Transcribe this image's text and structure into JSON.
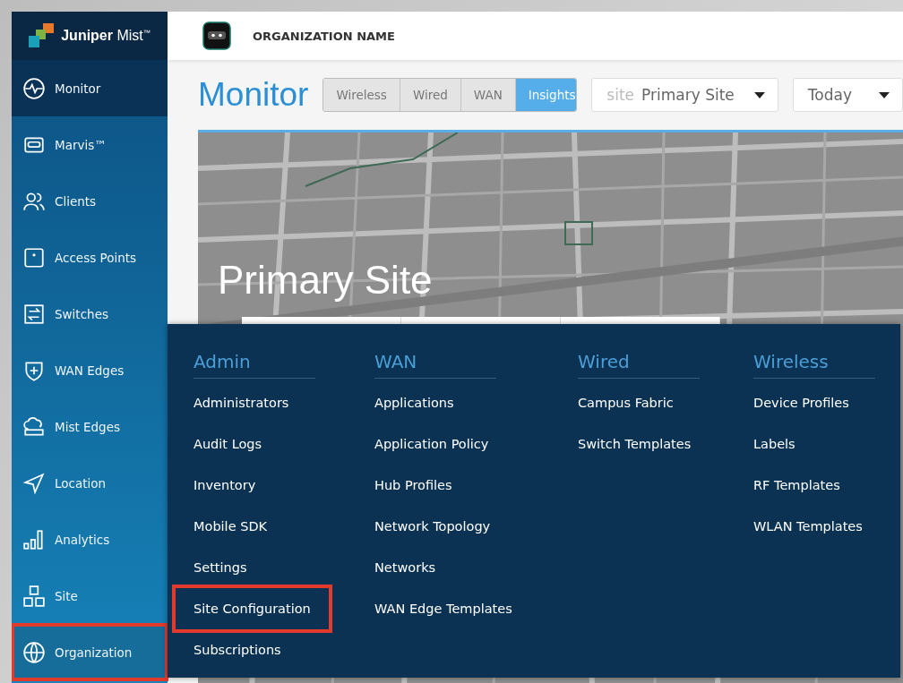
{
  "brand": {
    "name": "**Juniper** Mist$^{™}$"
  },
  "header": {
    "org_name": "ORGANIZATION NAME"
  },
  "sidebar": {
    "items": [
      {
        "label": "Monitor",
        "selected": true,
        "highlighted": false
      },
      {
        "label": "Marvis™",
        "selected": false,
        "highlighted": false
      },
      {
        "label": "Clients",
        "selected": false,
        "highlighted": false
      },
      {
        "label": "Access Points",
        "selected": false,
        "highlighted": false
      },
      {
        "label": "Switches",
        "selected": false,
        "highlighted": false
      },
      {
        "label": "WAN Edges",
        "selected": false,
        "highlighted": false
      },
      {
        "label": "Mist Edges",
        "selected": false,
        "highlighted": false
      },
      {
        "label": "Location",
        "selected": false,
        "highlighted": false
      },
      {
        "label": "Analytics",
        "selected": false,
        "highlighted": false
      },
      {
        "label": "Site",
        "selected": false,
        "highlighted": false
      },
      {
        "label": "Organization",
        "selected": false,
        "highlighted": true
      }
    ]
  },
  "page": {
    "title": "Monitor",
    "tabs": [
      {
        "label": "Wireless",
        "selected": false
      },
      {
        "label": "Wired",
        "selected": false
      },
      {
        "label": "WAN",
        "selected": false
      },
      {
        "label": "Insights",
        "selected": true
      }
    ],
    "site_filter": {
      "prefix": "site",
      "value": "Primary Site"
    },
    "time_filter": {
      "value": "Today"
    }
  },
  "map": {
    "kind": "picture",
    "site_name": "Primary Site"
  },
  "menu": {
    "columns": [
      {
        "heading": "Admin",
        "items": [
          {
            "label": "Administrators",
            "highlighted": false
          },
          {
            "label": "Audit Logs",
            "highlighted": false
          },
          {
            "label": "Inventory",
            "highlighted": false
          },
          {
            "label": "Mobile SDK",
            "highlighted": false
          },
          {
            "label": "Settings",
            "highlighted": false
          },
          {
            "label": "Site Configuration",
            "highlighted": true
          },
          {
            "label": "Subscriptions",
            "highlighted": false
          }
        ]
      },
      {
        "heading": "WAN",
        "items": [
          {
            "label": "Applications",
            "highlighted": false
          },
          {
            "label": "Application Policy",
            "highlighted": false
          },
          {
            "label": "Hub Profiles",
            "highlighted": false
          },
          {
            "label": "Network Topology",
            "highlighted": false
          },
          {
            "label": "Networks",
            "highlighted": false
          },
          {
            "label": "WAN Edge Templates",
            "highlighted": false
          }
        ]
      },
      {
        "heading": "Wired",
        "items": [
          {
            "label": "Campus Fabric",
            "highlighted": false
          },
          {
            "label": "Switch Templates",
            "highlighted": false
          }
        ]
      },
      {
        "heading": "Wireless",
        "items": [
          {
            "label": "Device Profiles",
            "highlighted": false
          },
          {
            "label": "Labels",
            "highlighted": false
          },
          {
            "label": "RF Templates",
            "highlighted": false
          },
          {
            "label": "WLAN Templates",
            "highlighted": false
          }
        ]
      }
    ]
  }
}
